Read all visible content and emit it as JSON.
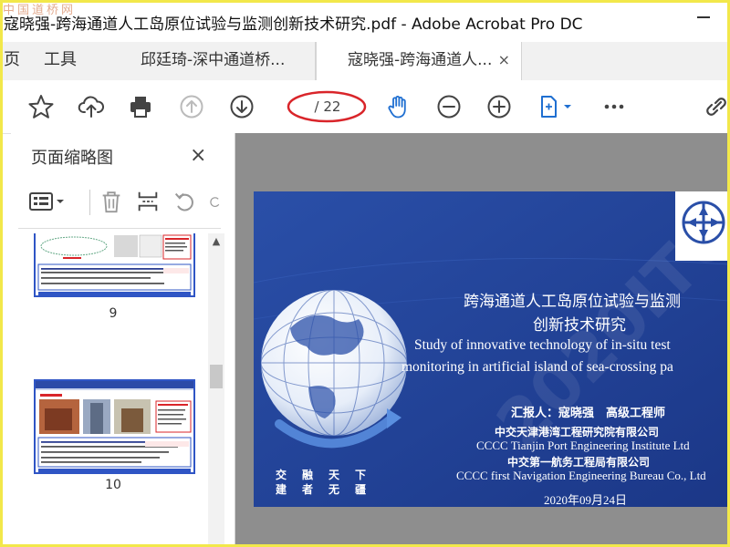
{
  "window": {
    "title": "寇晓强-跨海通道人工岛原位试验与监测创新技术研究.pdf - Adobe Acrobat Pro DC",
    "watermark_site": "中国道桥网"
  },
  "tabs": {
    "home_label": "页",
    "tools_label": "工具",
    "doc_tab_1": "邱廷琦-深中通道桥...",
    "doc_tab_2": "寇晓强-跨海通道人...",
    "close_glyph": "×"
  },
  "toolbar": {
    "page_indicator": "/ 22",
    "current_page": ""
  },
  "sidebar": {
    "title": "页面缩略图",
    "close_glyph": "×",
    "thumbnails": [
      {
        "page": "9"
      },
      {
        "page": "10"
      }
    ]
  },
  "slide": {
    "title_cn_line1": "跨海通道人工岛原位试验与监测",
    "title_cn_line2": "创新技术研究",
    "title_en_line1": "Study of innovative technology of in-situ test",
    "title_en_line2": "monitoring in artificial island of sea-crossing pa",
    "reporter": "汇报人：寇晓强　高级工程师",
    "org1_cn": "中交天津港湾工程研究院有限公司",
    "org1_en": "CCCC Tianjin Port Engineering Institute Ltd",
    "org2_cn": "中交第一航务工程局有限公司",
    "org2_en": "CCCC first Navigation Engineering Bureau Co., Ltd",
    "date": "2020年09月24日",
    "slogan_top": [
      "交",
      "融",
      "天",
      "下"
    ],
    "slogan_bottom": [
      "建",
      "者",
      "无",
      "疆"
    ],
    "watermark": "2020ITC"
  },
  "colors": {
    "accent_blue": "#2f55c5",
    "slide_blue": "#21439b",
    "annotation_red": "#d9252a",
    "hand_tool_blue": "#1f6fd1"
  }
}
